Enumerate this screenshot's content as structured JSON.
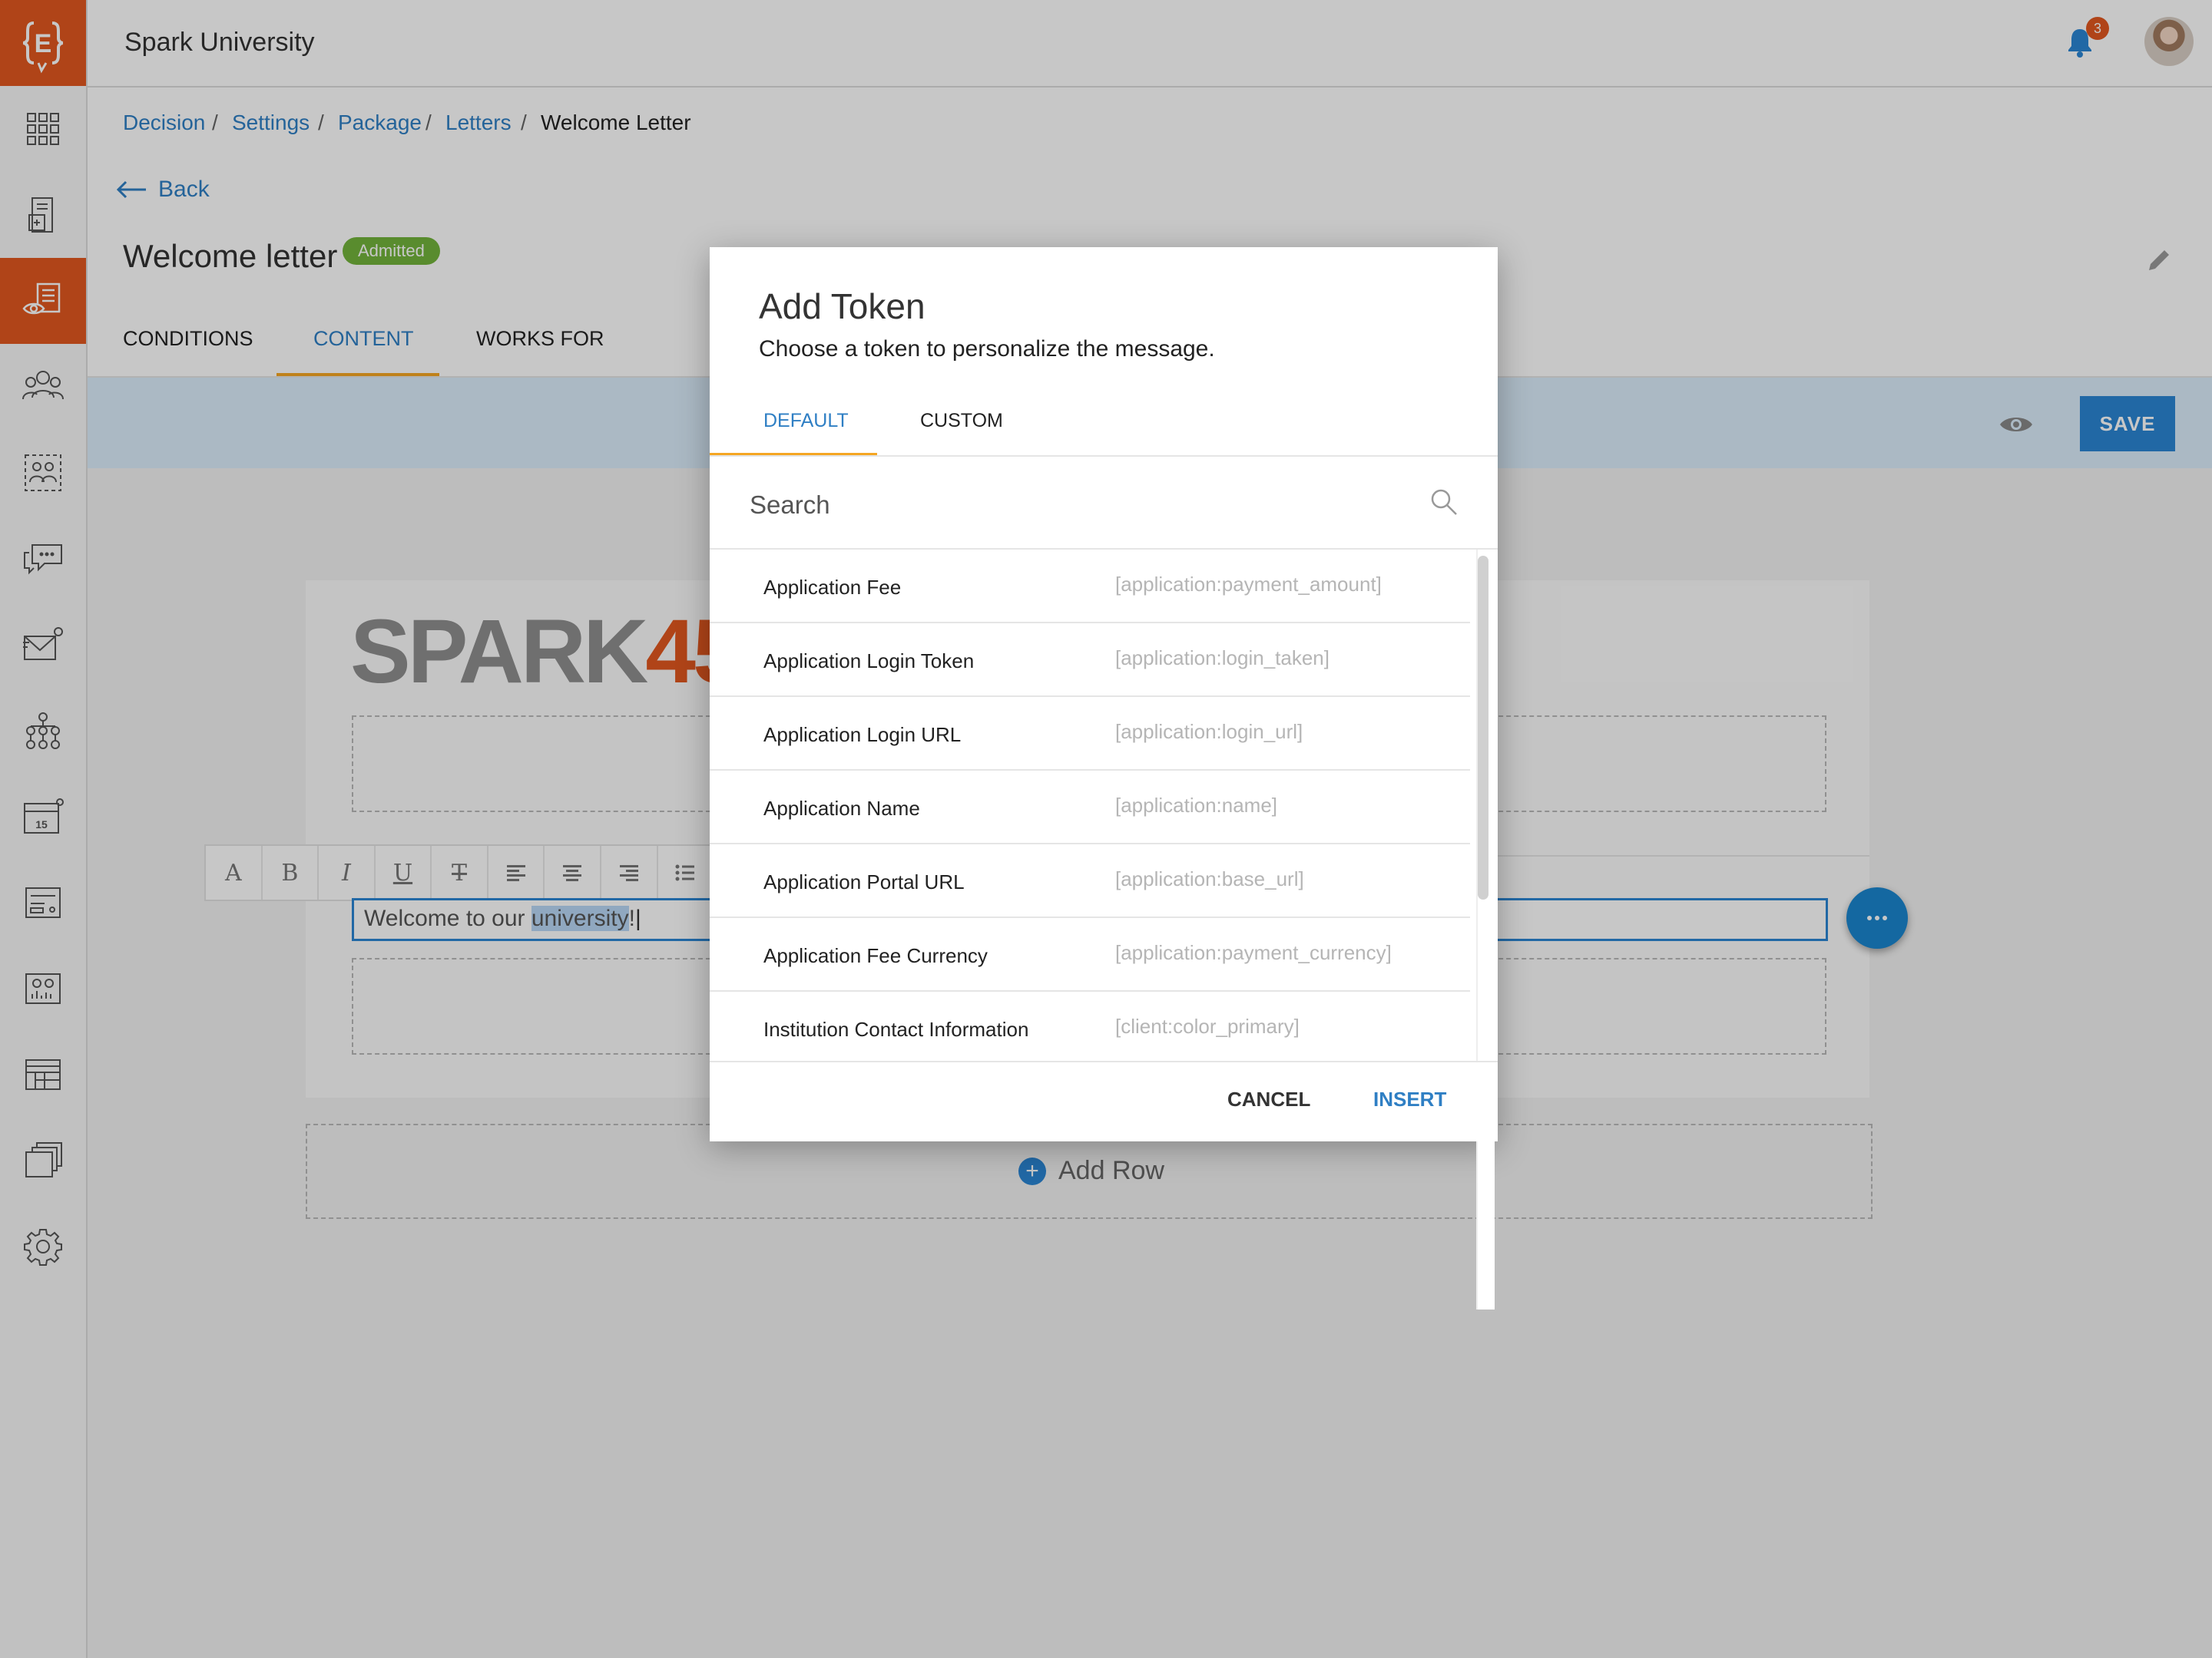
{
  "app": {
    "name": "Spark University",
    "notification_count": "3",
    "logo_letter": "E"
  },
  "sidebar": {
    "items": [
      {
        "icon": "apps-grid-icon"
      },
      {
        "icon": "document-calculator-icon"
      },
      {
        "icon": "letter-preview-icon",
        "active": true
      },
      {
        "icon": "users-group-icon"
      },
      {
        "icon": "users-dashed-icon"
      },
      {
        "icon": "chat-bubble-icon"
      },
      {
        "icon": "mail-send-icon"
      },
      {
        "icon": "hierarchy-icon"
      },
      {
        "icon": "calendar-icon",
        "calendar_day": "15"
      },
      {
        "icon": "form-icon"
      },
      {
        "icon": "report-icon"
      },
      {
        "icon": "table-icon"
      },
      {
        "icon": "files-icon"
      },
      {
        "icon": "gear-icon"
      }
    ]
  },
  "breadcrumb": [
    "Decision",
    "Settings",
    "Package",
    "Letters",
    "Welcome Letter"
  ],
  "back_label": "Back",
  "page": {
    "title": "Welcome letter",
    "status": "Admitted",
    "tabs": [
      "CONDITIONS",
      "CONTENT",
      "WORKS FOR"
    ],
    "active_tab": "CONTENT",
    "save_label": "SAVE"
  },
  "editor": {
    "logo": {
      "part1": "SPARK",
      "part2": "45"
    },
    "text_before": "Welcome to our ",
    "text_selected": "university",
    "text_after": "!",
    "toolbar": [
      "A",
      "B",
      "I",
      "U",
      "T",
      "align-left",
      "align-center",
      "align-right",
      "list"
    ],
    "add_row_label": "Add Row"
  },
  "modal": {
    "title": "Add Token",
    "subtitle": "Choose a token to personalize the message.",
    "tabs": [
      "DEFAULT",
      "CUSTOM"
    ],
    "active_tab": "DEFAULT",
    "search_placeholder": "Search",
    "tokens": [
      {
        "name": "Application Fee",
        "code": "[application:payment_amount]"
      },
      {
        "name": "Application Login Token",
        "code": "[application:login_taken]"
      },
      {
        "name": "Application Login URL",
        "code": "[application:login_url]"
      },
      {
        "name": "Application Name",
        "code": "[application:name]"
      },
      {
        "name": "Application Portal URL",
        "code": "[application:base_url]"
      },
      {
        "name": "Application Fee Currency",
        "code": "[application:payment_currency]"
      },
      {
        "name": "Institution Contact Information",
        "code": "[client:color_primary]"
      }
    ],
    "cancel_label": "CANCEL",
    "insert_label": "INSERT"
  },
  "colors": {
    "brand": "#e2581f",
    "accent": "#2b86d4",
    "tab_underline": "#f5a623",
    "badge": "#73b43c"
  }
}
